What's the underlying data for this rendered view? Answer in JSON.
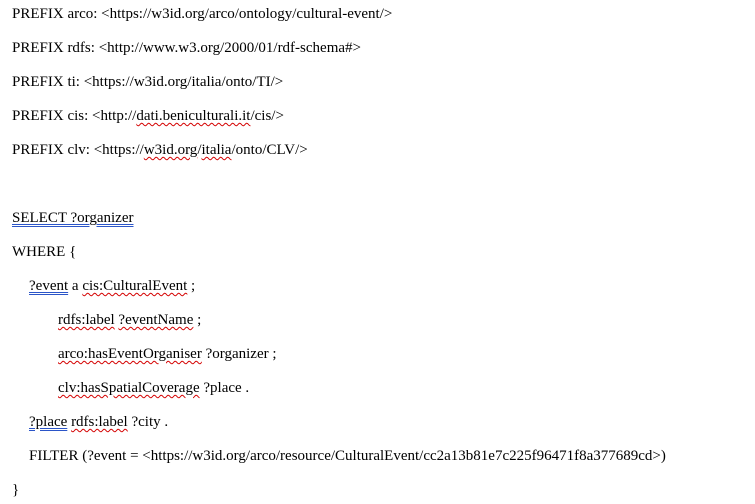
{
  "document": {
    "prefixes": [
      {
        "keyword": "PREFIX",
        "name": "arco:",
        "uri_open": "<https://w3id.org/arco/ontology/cultural-event/>"
      },
      {
        "keyword": "PREFIX",
        "name": "rdfs:",
        "uri_open": "<http://www.w3.org/2000/01/rdf-schema#>"
      },
      {
        "keyword": "PREFIX",
        "name": "ti:",
        "uri_open": "<https://w3id.org/italia/onto/TI/>"
      },
      {
        "keyword": "PREFIX",
        "name": "cis:",
        "uri_pre": "<http://",
        "uri_mark": "dati.beniculturali.it",
        "uri_post": "/cis/>"
      },
      {
        "keyword": "PREFIX",
        "name": "clv:",
        "uri_pre": "<https://",
        "uri_mark1": "w3id.org",
        "uri_mid": "/",
        "uri_mark2": "italia",
        "uri_post": "/onto/CLV/>"
      }
    ],
    "select_line": "SELECT ?organizer",
    "where_open": "WHERE {",
    "triple1": {
      "subject": "?event",
      "middle": " a ",
      "object": "cis:CulturalEvent",
      "end": " ;"
    },
    "triple2": {
      "pred": "rdfs:label",
      "space": " ",
      "obj": "?eventName",
      "end": " ;"
    },
    "triple3": {
      "pred": "arco:hasEventOrganiser",
      "end": " ?organizer ;"
    },
    "triple4": {
      "pred": "clv:hasSpatialCoverage",
      "end": " ?place ."
    },
    "triple5": {
      "subject": "?place",
      "space": " ",
      "pred": "rdfs:label",
      "end": " ?city ."
    },
    "filter_line": "FILTER (?event = <https://w3id.org/arco/resource/CulturalEvent/cc2a13b81e7c225f96471f8a377689cd>)",
    "close_brace": "}"
  },
  "colors": {
    "spelling_underline": "#d40000",
    "grammar_underline": "#2b55c8"
  }
}
